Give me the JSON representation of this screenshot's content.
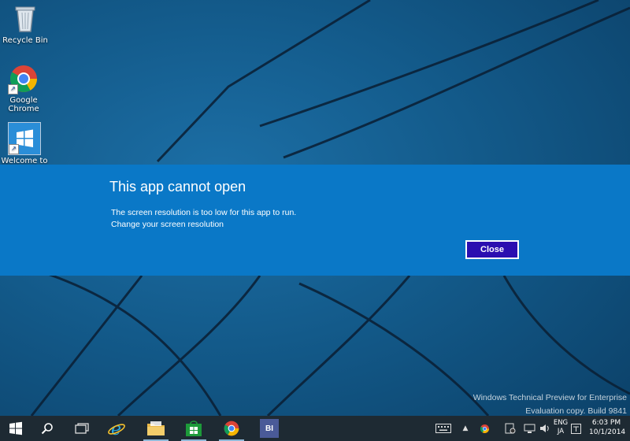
{
  "desktop": {
    "icons": [
      {
        "label": "Recycle Bin",
        "icon": "recycle-bin-icon"
      },
      {
        "label": "Google Chrome",
        "icon": "chrome-icon"
      },
      {
        "label": "Welcome to",
        "icon": "windows-logo-icon"
      }
    ]
  },
  "dialog": {
    "title": "This app cannot open",
    "message": "The screen resolution is too low for this app to run.",
    "link": "Change your screen resolution",
    "close_label": "Close",
    "background": "#0a78c7",
    "button_color": "#2b0fb0"
  },
  "watermark": {
    "line1": "Windows Technical Preview for Enterprise",
    "line2": "Evaluation copy. Build 9841"
  },
  "taskbar": {
    "start": "windows-start-icon",
    "search": "search-icon",
    "task_view": "task-view-icon",
    "apps": [
      "internet-explorer-icon",
      "file-explorer-icon",
      "store-icon",
      "chrome-icon",
      "app-bi-icon"
    ],
    "app_bi_label": "BI",
    "language_top": "ENG",
    "language_bottom": "JA",
    "time": "6:03 PM",
    "date": "10/1/2014"
  }
}
